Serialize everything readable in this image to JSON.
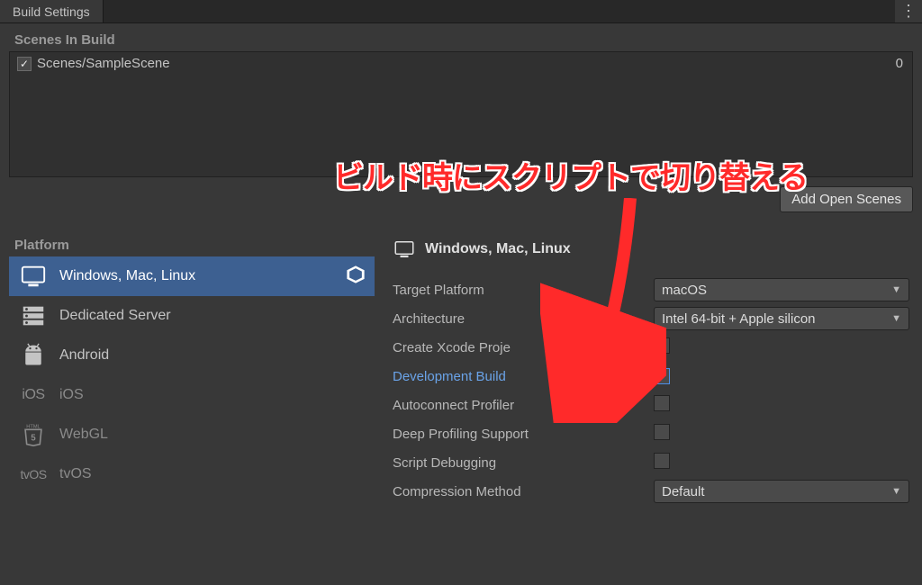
{
  "window": {
    "title": "Build Settings"
  },
  "scenes": {
    "header": "Scenes In Build",
    "items": [
      {
        "path": "Scenes/SampleScene",
        "index": "0",
        "checked": true
      }
    ],
    "addOpenScenes": "Add Open Scenes"
  },
  "platform": {
    "header": "Platform",
    "items": [
      {
        "label": "Windows, Mac, Linux"
      },
      {
        "label": "Dedicated Server"
      },
      {
        "label": "Android"
      },
      {
        "label": "iOS"
      },
      {
        "label": "WebGL"
      },
      {
        "label": "tvOS"
      }
    ]
  },
  "detail": {
    "title": "Windows, Mac, Linux",
    "props": {
      "targetPlatformLabel": "Target Platform",
      "targetPlatformValue": "macOS",
      "architectureLabel": "Architecture",
      "architectureValue": "Intel 64-bit + Apple silicon",
      "createXcodeLabel": "Create Xcode Proje",
      "devBuildLabel": "Development Build",
      "autoconnectProfilerLabel": "Autoconnect Profiler",
      "deepProfilingLabel": "Deep Profiling Support",
      "scriptDebugLabel": "Script Debugging",
      "compressionLabel": "Compression Method",
      "compressionValue": "Default",
      "devBuildChecked": true
    }
  },
  "annotation": {
    "text": "ビルド時にスクリプトで切り替える"
  },
  "iconLabels": {
    "ios": "iOS",
    "tvos": "tvOS",
    "html5": "HTML"
  }
}
